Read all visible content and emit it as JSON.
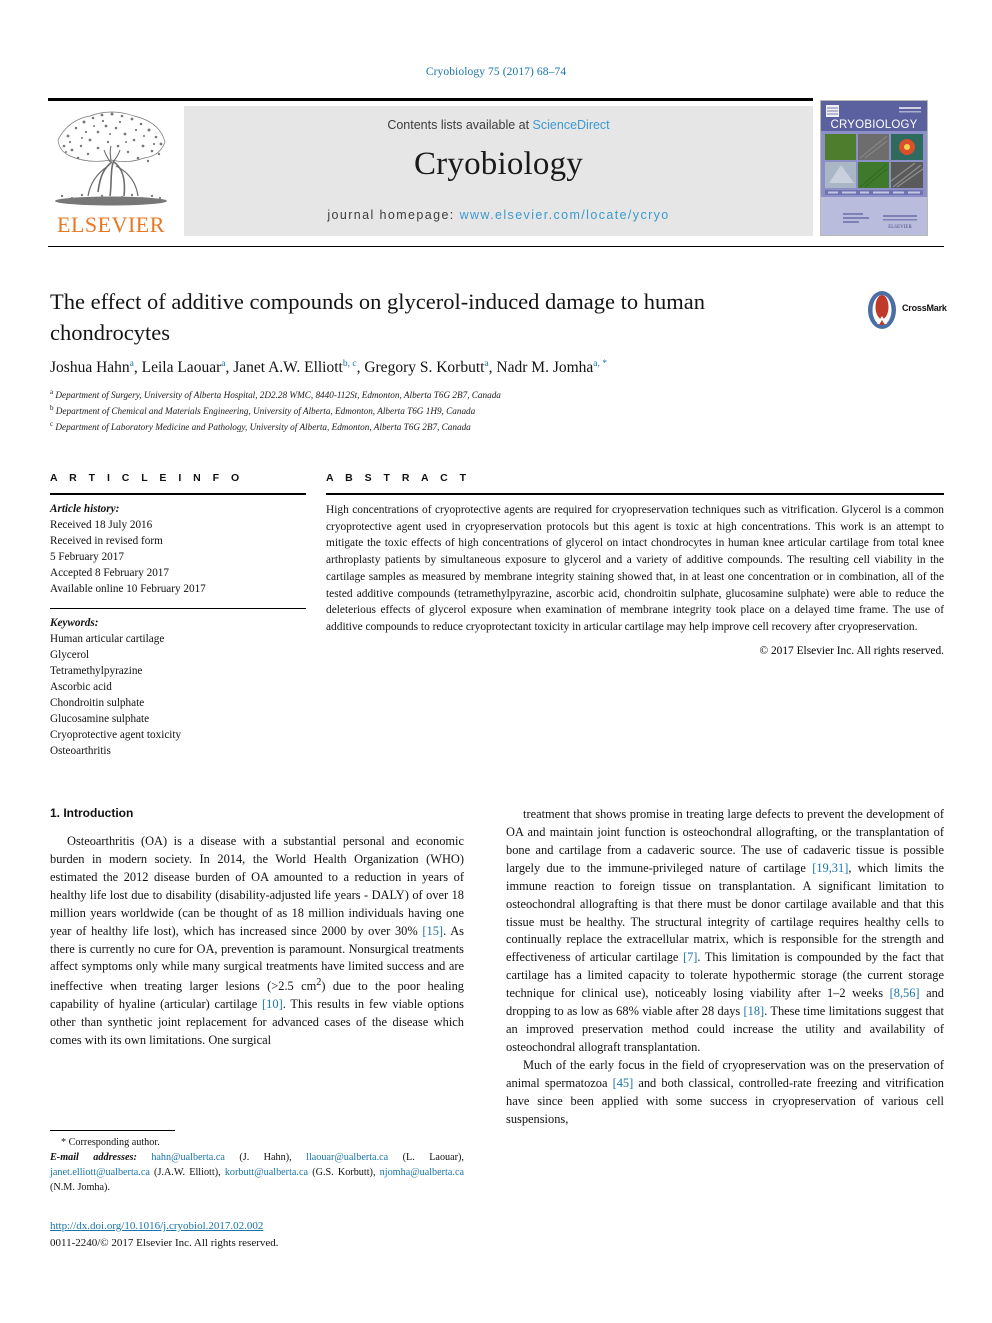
{
  "running_head": "Cryobiology 75 (2017) 68–74",
  "masthead": {
    "contents_prefix": "Contents lists available at ",
    "sciencedirect": "ScienceDirect",
    "journal_name": "Cryobiology",
    "homepage_prefix": "journal homepage: ",
    "homepage_url": "www.elsevier.com/locate/ycryo",
    "publisher": "ELSEVIER",
    "cover_title": "CRYOBIOLOGY"
  },
  "article": {
    "title": "The effect of additive compounds on glycerol-induced damage to human chondrocytes",
    "crossmark_label": "CrossMark",
    "authors": [
      {
        "name": "Joshua Hahn",
        "marks": "a"
      },
      {
        "name": "Leila Laouar",
        "marks": "a"
      },
      {
        "name": "Janet A.W. Elliott",
        "marks": "b, c"
      },
      {
        "name": "Gregory S. Korbutt",
        "marks": "a"
      },
      {
        "name": "Nadr M. Jomha",
        "marks": "a, *"
      }
    ],
    "affiliations": [
      {
        "mark": "a",
        "text": "Department of Surgery, University of Alberta Hospital, 2D2.28 WMC, 8440-112St, Edmonton, Alberta T6G 2B7, Canada"
      },
      {
        "mark": "b",
        "text": "Department of Chemical and Materials Engineering, University of Alberta, Edmonton, Alberta T6G 1H9, Canada"
      },
      {
        "mark": "c",
        "text": "Department of Laboratory Medicine and Pathology, University of Alberta, Edmonton, Alberta T6G 2B7, Canada"
      }
    ]
  },
  "article_info": {
    "heading": "A R T I C L E   I N F O",
    "history_label": "Article history:",
    "history": [
      "Received 18 July 2016",
      "Received in revised form",
      "5 February 2017",
      "Accepted 8 February 2017",
      "Available online 10 February 2017"
    ],
    "keywords_label": "Keywords:",
    "keywords": [
      "Human articular cartilage",
      "Glycerol",
      "Tetramethylpyrazine",
      "Ascorbic acid",
      "Chondroitin sulphate",
      "Glucosamine sulphate",
      "Cryoprotective agent toxicity",
      "Osteoarthritis"
    ]
  },
  "abstract": {
    "heading": "A B S T R A C T",
    "text": "High concentrations of cryoprotective agents are required for cryopreservation techniques such as vitrification. Glycerol is a common cryoprotective agent used in cryopreservation protocols but this agent is toxic at high concentrations. This work is an attempt to mitigate the toxic effects of high concentrations of glycerol on intact chondrocytes in human knee articular cartilage from total knee arthroplasty patients by simultaneous exposure to glycerol and a variety of additive compounds. The resulting cell viability in the cartilage samples as measured by membrane integrity staining showed that, in at least one concentration or in combination, all of the tested additive compounds (tetramethylpyrazine, ascorbic acid, chondroitin sulphate, glucosamine sulphate) were able to reduce the deleterious effects of glycerol exposure when examination of membrane integrity took place on a delayed time frame. The use of additive compounds to reduce cryoprotectant toxicity in articular cartilage may help improve cell recovery after cryopreservation.",
    "copyright": "© 2017 Elsevier Inc. All rights reserved."
  },
  "body": {
    "section_heading": "1. Introduction",
    "left_paragraphs": [
      "Osteoarthritis (OA) is a disease with a substantial personal and economic burden in modern society. In 2014, the World Health Organization (WHO) estimated the 2012 disease burden of OA amounted to a reduction in years of healthy life lost due to disability (disability-adjusted life years - DALY) of over 18 million years worldwide (can be thought of as 18 million individuals having one year of healthy life lost), which has increased since 2000 by over 30% [15]. As there is currently no cure for OA, prevention is paramount. Nonsurgical treatments affect symptoms only while many surgical treatments have limited success and are ineffective when treating larger lesions (>2.5 cm2) due to the poor healing capability of hyaline (articular) cartilage [10]. This results in few viable options other than synthetic joint replacement for advanced cases of the disease which comes with its own limitations. One surgical"
    ],
    "right_paragraphs": [
      "treatment that shows promise in treating large defects to prevent the development of OA and maintain joint function is osteochondral allografting, or the transplantation of bone and cartilage from a cadaveric source. The use of cadaveric tissue is possible largely due to the immune-privileged nature of cartilage [19,31], which limits the immune reaction to foreign tissue on transplantation. A significant limitation to osteochondral allografting is that there must be donor cartilage available and that this tissue must be healthy. The structural integrity of cartilage requires healthy cells to continually replace the extracellular matrix, which is responsible for the strength and effectiveness of articular cartilage [7]. This limitation is compounded by the fact that cartilage has a limited capacity to tolerate hypothermic storage (the current storage technique for clinical use), noticeably losing viability after 1–2 weeks [8,56] and dropping to as low as 68% viable after 28 days [18]. These time limitations suggest that an improved preservation method could increase the utility and availability of osteochondral allograft transplantation.",
      "Much of the early focus in the field of cryopreservation was on the preservation of animal spermatozoa [45] and both classical, controlled-rate freezing and vitrification have since been applied with some success in cryopreservation of various cell suspensions,"
    ]
  },
  "footnote": {
    "corresponding": "* Corresponding author.",
    "email_label": "E-mail addresses:",
    "emails": [
      {
        "address": "hahn@ualberta.ca",
        "owner": "(J. Hahn),"
      },
      {
        "address": "llaouar@ualberta.ca",
        "owner": "(L. Laouar),"
      },
      {
        "address": "janet.elliott@ualberta.ca",
        "owner": "(J.A.W. Elliott),"
      },
      {
        "address": "korbutt@ualberta.ca",
        "owner": "(G.S. Korbutt),"
      },
      {
        "address": "njomha@ualberta.ca",
        "owner": "(N.M. Jomha)."
      }
    ],
    "doi": "http://dx.doi.org/10.1016/j.cryobiol.2017.02.002",
    "issn": "0011-2240/© 2017 Elsevier Inc. All rights reserved."
  },
  "colors": {
    "link": "#1a74a8",
    "sciencedirect": "#3c9ad0",
    "elsevier_orange": "#e87722",
    "band": "#e6e6e6"
  }
}
